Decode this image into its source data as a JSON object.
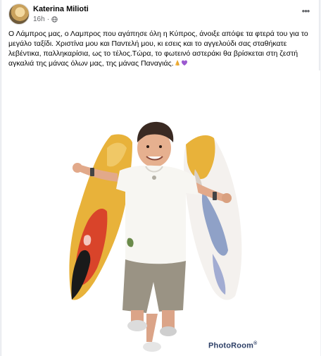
{
  "post": {
    "author": "Katerina Milioti",
    "time": "16h",
    "body": "Ο Λάμπρος μας, ο Λαμπρος που αγάπησε όλη η Κύπρος, άνοιξε απόψε τα φτερά του για το μεγάλο ταξίδι. Χριστίνα μου και Παντελή μου, κι εσεις και το αγγελούδι σας σταθήκατε λεβέντικα, παλληκαρίσια, ως το τέλος.Τώρα, το φωτεινό αστεράκι θα βρίσκεται στη ζεστή αγκαλιά της μάνας όλων μας, της μάνας Παναγιάς.",
    "emojis": [
      "praying-hands-icon",
      "purple-heart-icon"
    ],
    "more_label": "•••"
  },
  "photo": {
    "watermark": "PhotoRoom",
    "watermark_mark": "®"
  },
  "colors": {
    "author": "#050505",
    "meta": "#65676b",
    "wing_yellow": "#e8b23a",
    "wing_red": "#d9442a",
    "wing_blue": "#3d5fa8"
  }
}
